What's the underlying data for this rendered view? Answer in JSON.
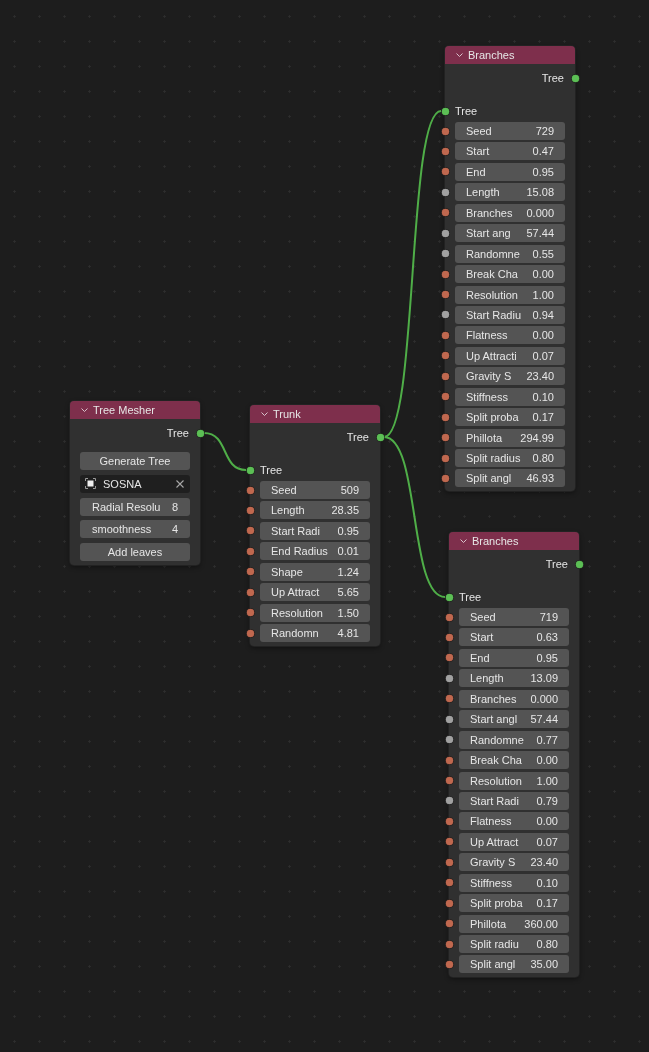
{
  "node_tree": {
    "title": "Tree Mesher",
    "outputs": [
      {
        "label": "Tree"
      }
    ],
    "items": [
      {
        "kind": "button",
        "label": "Generate Tree"
      },
      {
        "kind": "object",
        "value": "SOSNA"
      },
      {
        "kind": "number",
        "label": "Radial Resolu",
        "value": "8"
      },
      {
        "kind": "number",
        "label": "smoothness",
        "value": "4"
      },
      {
        "kind": "button",
        "label": "Add leaves"
      }
    ],
    "children": [
      {
        "title": "Trunk",
        "outputs": [
          {
            "label": "Tree"
          }
        ],
        "inputs": [
          {
            "label": "Tree"
          }
        ],
        "items": [
          {
            "kind": "socket_number",
            "label": "Seed",
            "value": "509",
            "color": "#c0684f"
          },
          {
            "kind": "socket_number",
            "label": "Length",
            "value": "28.35",
            "color": "#c0684f"
          },
          {
            "kind": "socket_number",
            "label": "Start Radi",
            "value": "0.95",
            "color": "#c0684f"
          },
          {
            "kind": "socket_number",
            "label": "End Radius",
            "value": "0.01",
            "color": "#c0684f"
          },
          {
            "kind": "socket_number",
            "label": "Shape",
            "value": "1.24",
            "color": "#c0684f"
          },
          {
            "kind": "socket_number",
            "label": "Up Attract",
            "value": "5.65",
            "color": "#c0684f"
          },
          {
            "kind": "socket_number",
            "label": "Resolution",
            "value": "1.50",
            "color": "#c0684f"
          },
          {
            "kind": "socket_number",
            "label": "Randomn",
            "value": "4.81",
            "color": "#c0684f"
          }
        ],
        "children": [
          {
            "title": "Branches",
            "outputs": [
              {
                "label": "Tree"
              }
            ],
            "inputs": [
              {
                "label": "Tree"
              }
            ],
            "items": [
              {
                "kind": "socket_number",
                "label": "Seed",
                "value": "729",
                "color": "#c0684f"
              },
              {
                "kind": "socket_number",
                "label": "Start",
                "value": "0.47",
                "color": "#c0684f"
              },
              {
                "kind": "socket_number",
                "label": "End",
                "value": "0.95",
                "color": "#c0684f"
              },
              {
                "kind": "socket_number",
                "label": "Length",
                "value": "15.08",
                "color": "#a1a1a1"
              },
              {
                "kind": "socket_number",
                "label": "Branches",
                "value": "0.000",
                "color": "#c0684f"
              },
              {
                "kind": "socket_number",
                "label": "Start ang",
                "value": "57.44",
                "color": "#a1a1a1"
              },
              {
                "kind": "socket_number",
                "label": "Randomne",
                "value": "0.55",
                "color": "#a1a1a1"
              },
              {
                "kind": "socket_number",
                "label": "Break Cha",
                "value": "0.00",
                "color": "#c0684f"
              },
              {
                "kind": "socket_number",
                "label": "Resolution",
                "value": "1.00",
                "color": "#c0684f"
              },
              {
                "kind": "socket_number",
                "label": "Start Radiu",
                "value": "0.94",
                "color": "#a1a1a1"
              },
              {
                "kind": "socket_number",
                "label": "Flatness",
                "value": "0.00",
                "color": "#c0684f"
              },
              {
                "kind": "socket_number",
                "label": "Up Attracti",
                "value": "0.07",
                "color": "#c0684f"
              },
              {
                "kind": "socket_number",
                "label": "Gravity S",
                "value": "23.40",
                "color": "#c0684f"
              },
              {
                "kind": "socket_number",
                "label": "Stiffness",
                "value": "0.10",
                "color": "#c0684f"
              },
              {
                "kind": "socket_number",
                "label": "Split proba",
                "value": "0.17",
                "color": "#c0684f"
              },
              {
                "kind": "socket_number",
                "label": "Phillota",
                "value": "294.99",
                "color": "#c0684f"
              },
              {
                "kind": "socket_number",
                "label": "Split radius",
                "value": "0.80",
                "color": "#c0684f"
              },
              {
                "kind": "socket_number",
                "label": "Split angl",
                "value": "46.93",
                "color": "#c0684f"
              }
            ]
          },
          {
            "title": "Branches",
            "outputs": [
              {
                "label": "Tree"
              }
            ],
            "inputs": [
              {
                "label": "Tree"
              }
            ],
            "items": [
              {
                "kind": "socket_number",
                "label": "Seed",
                "value": "719",
                "color": "#c0684f"
              },
              {
                "kind": "socket_number",
                "label": "Start",
                "value": "0.63",
                "color": "#c0684f"
              },
              {
                "kind": "socket_number",
                "label": "End",
                "value": "0.95",
                "color": "#c0684f"
              },
              {
                "kind": "socket_number",
                "label": "Length",
                "value": "13.09",
                "color": "#a1a1a1"
              },
              {
                "kind": "socket_number",
                "label": "Branches",
                "value": "0.000",
                "color": "#c0684f"
              },
              {
                "kind": "socket_number",
                "label": "Start angl",
                "value": "57.44",
                "color": "#a1a1a1"
              },
              {
                "kind": "socket_number",
                "label": "Randomne",
                "value": "0.77",
                "color": "#a1a1a1"
              },
              {
                "kind": "socket_number",
                "label": "Break Cha",
                "value": "0.00",
                "color": "#c0684f"
              },
              {
                "kind": "socket_number",
                "label": "Resolution",
                "value": "1.00",
                "color": "#c0684f"
              },
              {
                "kind": "socket_number",
                "label": "Start Radi",
                "value": "0.79",
                "color": "#a1a1a1"
              },
              {
                "kind": "socket_number",
                "label": "Flatness",
                "value": "0.00",
                "color": "#c0684f"
              },
              {
                "kind": "socket_number",
                "label": "Up Attract",
                "value": "0.07",
                "color": "#c0684f"
              },
              {
                "kind": "socket_number",
                "label": "Gravity S",
                "value": "23.40",
                "color": "#c0684f"
              },
              {
                "kind": "socket_number",
                "label": "Stiffness",
                "value": "0.10",
                "color": "#c0684f"
              },
              {
                "kind": "socket_number",
                "label": "Split proba",
                "value": "0.17",
                "color": "#c0684f"
              },
              {
                "kind": "socket_number",
                "label": "Phillota",
                "value": "360.00",
                "color": "#c0684f"
              },
              {
                "kind": "socket_number",
                "label": "Split radiu",
                "value": "0.80",
                "color": "#c0684f"
              },
              {
                "kind": "socket_number",
                "label": "Split angl",
                "value": "35.00",
                "color": "#c0684f"
              }
            ]
          }
        ]
      }
    ]
  }
}
